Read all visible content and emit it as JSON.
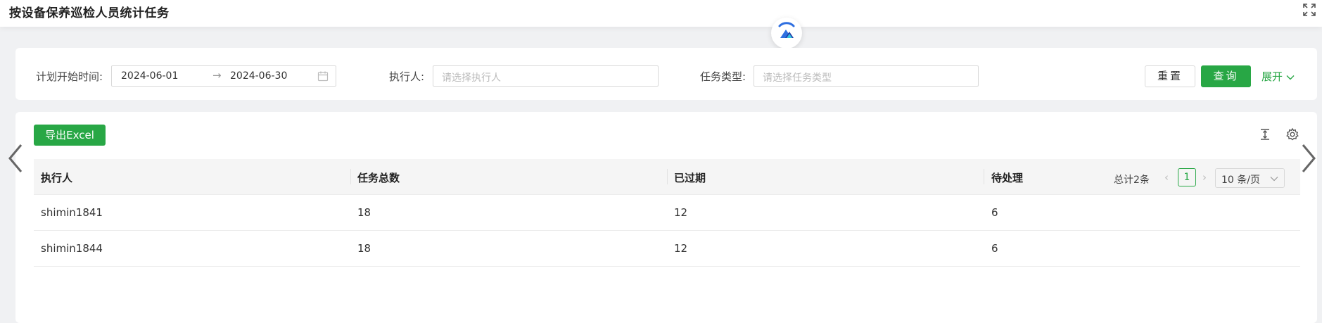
{
  "page": {
    "title": "按设备保养巡检人员统计任务"
  },
  "filters": {
    "plan_start_label": "计划开始时间:",
    "date_start": "2024-06-01",
    "date_separator": "→",
    "date_end": "2024-06-30",
    "executor_label": "执行人:",
    "executor_placeholder": "请选择执行人",
    "task_type_label": "任务类型:",
    "task_type_placeholder": "请选择任务类型",
    "reset_label": "重置",
    "query_label": "查询",
    "expand_label": "展开"
  },
  "toolbar": {
    "export_label": "导出Excel"
  },
  "table": {
    "columns": [
      "执行人",
      "任务总数",
      "已过期",
      "待处理"
    ],
    "rows": [
      [
        "shimin1841",
        "18",
        "12",
        "6"
      ],
      [
        "shimin1844",
        "18",
        "12",
        "6"
      ]
    ]
  },
  "pagination": {
    "total_text": "总计2条",
    "current_page": "1",
    "page_size": "10 条/页"
  },
  "colors": {
    "primary": "#28a745",
    "background": "#f0f1f3",
    "header_bg": "#f5f5f5"
  },
  "icons": [
    "fullscreen-icon",
    "app-logo-icon",
    "calendar-icon",
    "chevron-down-icon",
    "column-height-icon",
    "settings-icon",
    "chevron-left-icon",
    "chevron-right-icon"
  ]
}
